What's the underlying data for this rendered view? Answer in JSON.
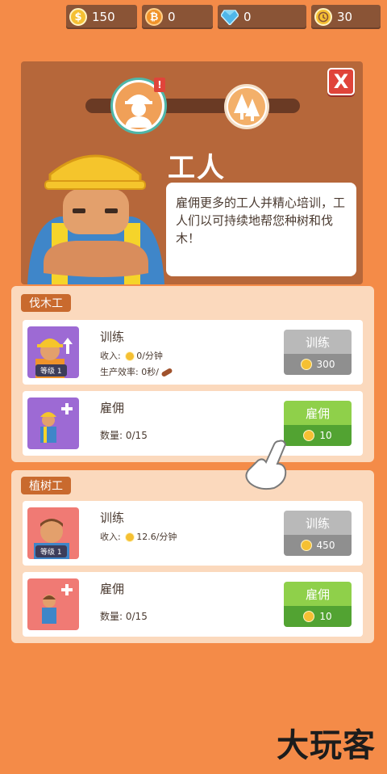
{
  "currencies": [
    {
      "icon": "gold-coin-icon",
      "glyph": "$",
      "value": "150"
    },
    {
      "icon": "bitcoin-icon",
      "glyph": "₿",
      "value": "0"
    },
    {
      "icon": "diamond-icon",
      "glyph": "",
      "value": "0"
    },
    {
      "icon": "clock-icon",
      "glyph": "",
      "value": "30"
    }
  ],
  "header": {
    "title": "工人",
    "description": "雇佣更多的工人并精心培训，工人们以可持续地帮您种树和伐木！",
    "alert_mark": "!",
    "close_glyph": "X"
  },
  "sections": [
    {
      "tag": "伐木工",
      "train": {
        "title": "训练",
        "income_label": "收入:",
        "income_value": "0/分钟",
        "efficiency_label": "生产效率:",
        "efficiency_value": "0秒/",
        "level_badge": "等级 1",
        "button_label": "训练",
        "button_cost": "300",
        "button_state": "disabled"
      },
      "hire": {
        "title": "雇佣",
        "count_label": "数量:",
        "count_value": "0/15",
        "button_label": "雇佣",
        "button_cost": "10",
        "button_state": "enabled"
      }
    },
    {
      "tag": "植树工",
      "train": {
        "title": "训练",
        "income_label": "收入:",
        "income_value": "12.6/分钟",
        "level_badge": "等级 1",
        "button_label": "训练",
        "button_cost": "450",
        "button_state": "disabled"
      },
      "hire": {
        "title": "雇佣",
        "count_label": "数量:",
        "count_value": "0/15",
        "button_label": "雇佣",
        "button_cost": "10",
        "button_state": "enabled"
      }
    }
  ],
  "watermark": "大玩客",
  "colors": {
    "background": "#f48b48",
    "panel": "#b6673a",
    "green_button": "#8fd04a",
    "gray_button": "#b9b9b9"
  }
}
